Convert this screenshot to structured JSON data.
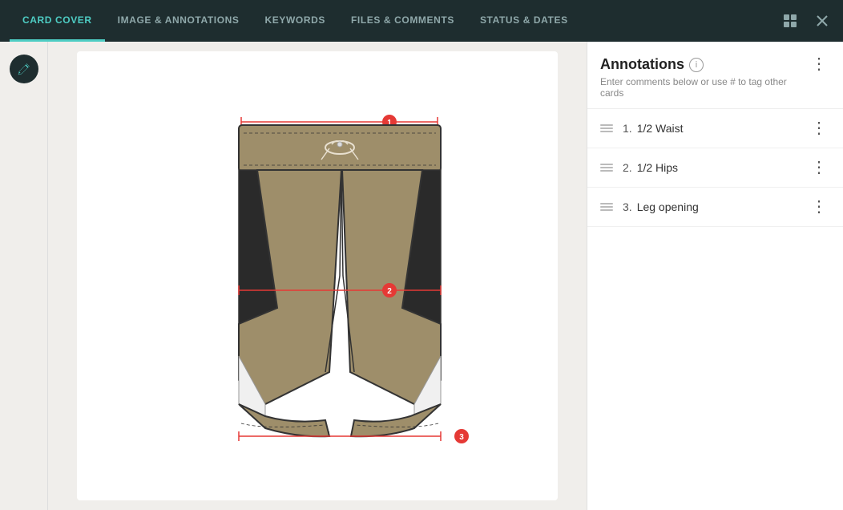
{
  "nav": {
    "tabs": [
      {
        "id": "card-cover",
        "label": "CARD COVER",
        "active": true
      },
      {
        "id": "image-annotations",
        "label": "IMAGE & ANNOTATIONS",
        "active": false
      },
      {
        "id": "keywords",
        "label": "KEYWORDS",
        "active": false
      },
      {
        "id": "files-comments",
        "label": "FILES & COMMENTS",
        "active": false
      },
      {
        "id": "status-dates",
        "label": "STATUS & DATES",
        "active": false
      }
    ],
    "grid_icon": "⊞",
    "close_icon": "✕"
  },
  "sidebar": {
    "edit_icon": "✎"
  },
  "annotations_panel": {
    "title": "Annotations",
    "subtitle": "Enter comments below or use # to tag other cards",
    "info_icon": "i",
    "items": [
      {
        "number": "1.",
        "label": "1/2 Waist"
      },
      {
        "number": "2.",
        "label": "1/2 Hips"
      },
      {
        "number": "3.",
        "label": "Leg opening"
      }
    ]
  },
  "image": {
    "alt": "Athletic shorts technical flat sketch with measurement annotations"
  }
}
